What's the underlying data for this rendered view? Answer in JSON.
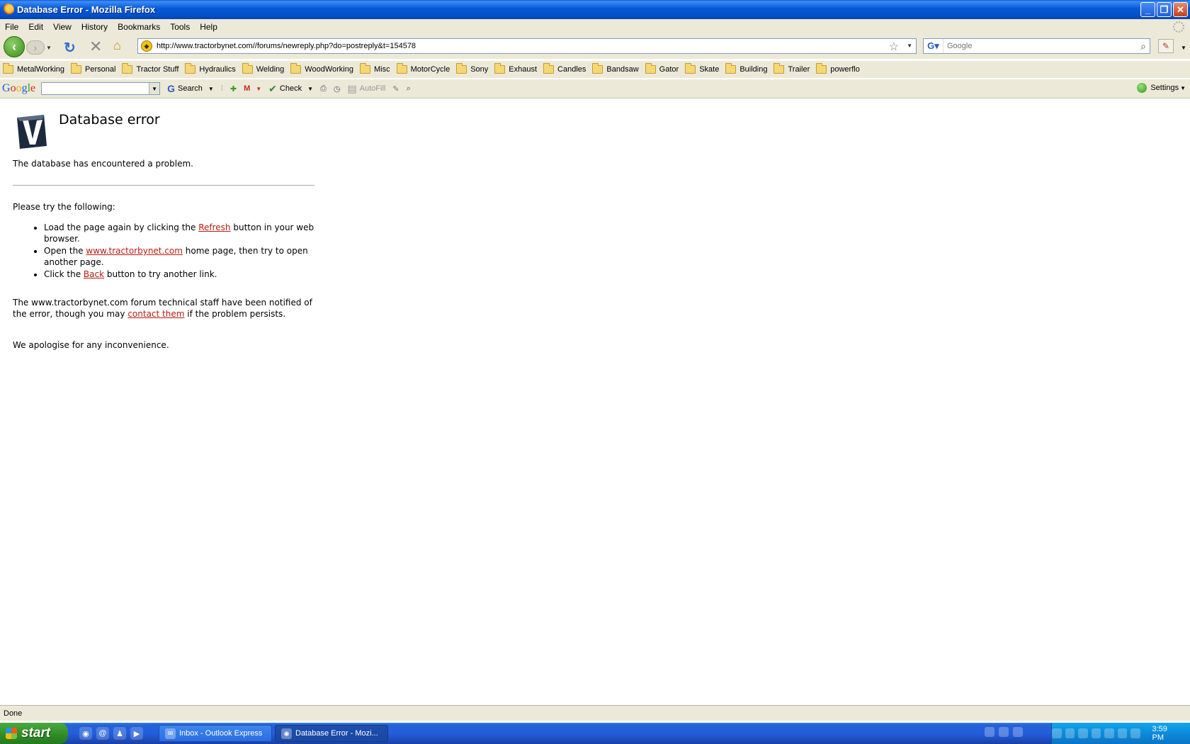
{
  "window": {
    "title": "Database Error - Mozilla Firefox"
  },
  "menu": [
    "File",
    "Edit",
    "View",
    "History",
    "Bookmarks",
    "Tools",
    "Help"
  ],
  "nav": {
    "url": "http://www.tractorbynet.com//forums/newreply.php?do=postreply&t=154578",
    "search_placeholder": "Google"
  },
  "bookmarks": [
    "MetalWorking",
    "Personal",
    "Tractor Stuff",
    "Hydraulics",
    "Welding",
    "WoodWorking",
    "Misc",
    "MotorCycle",
    "Sony",
    "Exhaust",
    "Candles",
    "Bandsaw",
    "Gator",
    "Skate",
    "Building",
    "Trailer",
    "powerflo"
  ],
  "google_toolbar": {
    "search_label": "Search",
    "check_label": "Check",
    "autofill_label": "AutoFill",
    "settings_label": "Settings"
  },
  "page": {
    "title": "Database error",
    "lead": "The database has encountered a problem.",
    "try_heading": "Please try the following:",
    "steps": {
      "s1_before": "Load the page again by clicking the ",
      "s1_link": "Refresh",
      "s1_after": " button in your web browser.",
      "s2_before": "Open the ",
      "s2_link": "www.tractorbynet.com",
      "s2_after": " home page, then try to open another page.",
      "s3_before": "Click the ",
      "s3_link": "Back",
      "s3_after": " button to try another link."
    },
    "notified_before": "The www.tractorbynet.com forum technical staff have been notified of the error, though you may ",
    "notified_link": "contact them",
    "notified_after": " if the problem persists.",
    "apology": "We apologise for any inconvenience."
  },
  "status": "Done",
  "taskbar": {
    "start": "start",
    "tasks": [
      "Inbox - Outlook Express",
      "Database Error - Mozi..."
    ],
    "clock": "3:59 PM"
  }
}
